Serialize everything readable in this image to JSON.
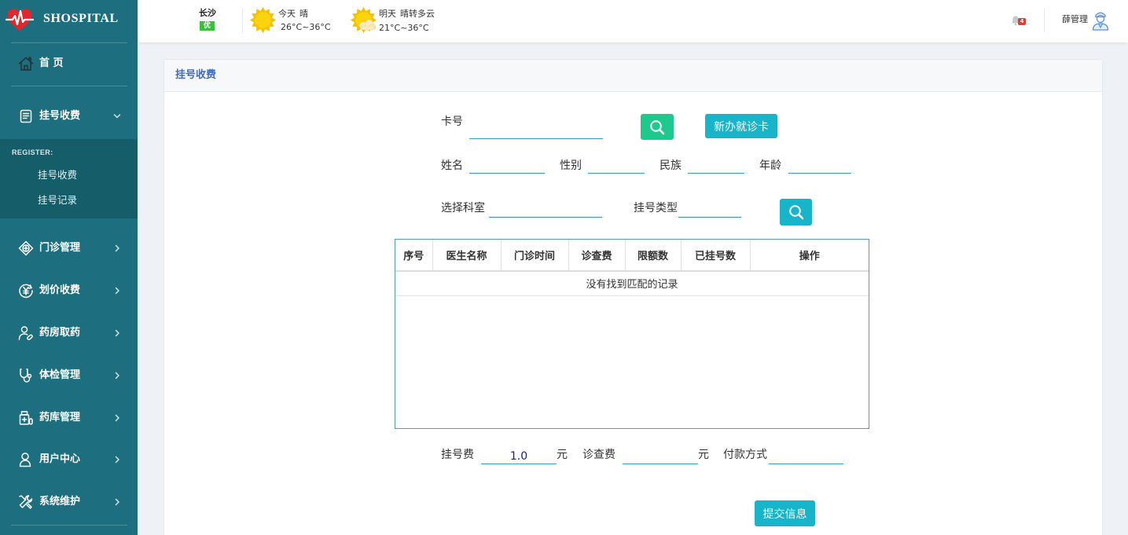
{
  "brand": {
    "name": "SHOSPITAL",
    "logo_icon": "heart-ecg-icon",
    "logo_color": "#e3262b"
  },
  "theme": {
    "sidebar_bg": "#1d6f7f",
    "submenu_bg": "#165d6a",
    "accent": "#18b4c9",
    "search_green": "#1ec98c",
    "title_blue": "#3f6ac8",
    "badge_green": "#38c13b",
    "badge_red": "#e53935"
  },
  "sidebar": {
    "home": {
      "label": "首 页",
      "icon": "home-icon"
    },
    "register": {
      "label": "挂号收费",
      "icon": "register-icon",
      "expanded": true
    },
    "submenu": {
      "heading": "REGISTER:",
      "items": [
        {
          "label": "挂号收费"
        },
        {
          "label": "挂号记录"
        }
      ]
    },
    "items": [
      {
        "label": "门诊管理",
        "icon": "outpatient-icon"
      },
      {
        "label": "划价收费",
        "icon": "yuan-icon"
      },
      {
        "label": "药房取药",
        "icon": "pharmacy-icon"
      },
      {
        "label": "体检管理",
        "icon": "stethoscope-icon"
      },
      {
        "label": "药库管理",
        "icon": "medicine-storage-icon"
      },
      {
        "label": "用户中心",
        "icon": "user-icon"
      },
      {
        "label": "系统维护",
        "icon": "tools-icon"
      }
    ]
  },
  "header": {
    "city": "长沙",
    "air_quality": "优",
    "today": {
      "day": "今天",
      "weather": "晴",
      "temp": "26°C~36°C",
      "icon": "sun-icon"
    },
    "tomorrow": {
      "day": "明天",
      "weather": "晴转多云",
      "temp": "21°C~36°C",
      "icon": "sun-cloud-icon"
    },
    "notifications": {
      "icon": "bell-icon",
      "count": "4"
    },
    "user": {
      "name": "薛管理",
      "avatar": "doctor-avatar-icon"
    }
  },
  "page": {
    "title": "挂号收费",
    "card_search": {
      "label": "卡号",
      "search_icon": "search-icon",
      "new_card_label": "新办就诊卡"
    },
    "patient": {
      "name_label": "姓名",
      "gender_label": "性别",
      "ethnicity_label": "民族",
      "age_label": "年龄"
    },
    "department": {
      "label": "选择科室",
      "type_label": "挂号类型",
      "search_icon": "search-icon"
    },
    "table": {
      "columns": [
        "序号",
        "医生名称",
        "门诊时间",
        "诊查费",
        "限额数",
        "已挂号数",
        "操作"
      ],
      "rows": [],
      "empty_text": "没有找到匹配的记录"
    },
    "fees": {
      "registration_fee_label": "挂号费",
      "registration_fee": "1.0",
      "registration_unit": "元",
      "exam_fee_label": "诊查费",
      "exam_unit": "元",
      "payment_label": "付款方式"
    },
    "submit_label": "提交信息"
  }
}
